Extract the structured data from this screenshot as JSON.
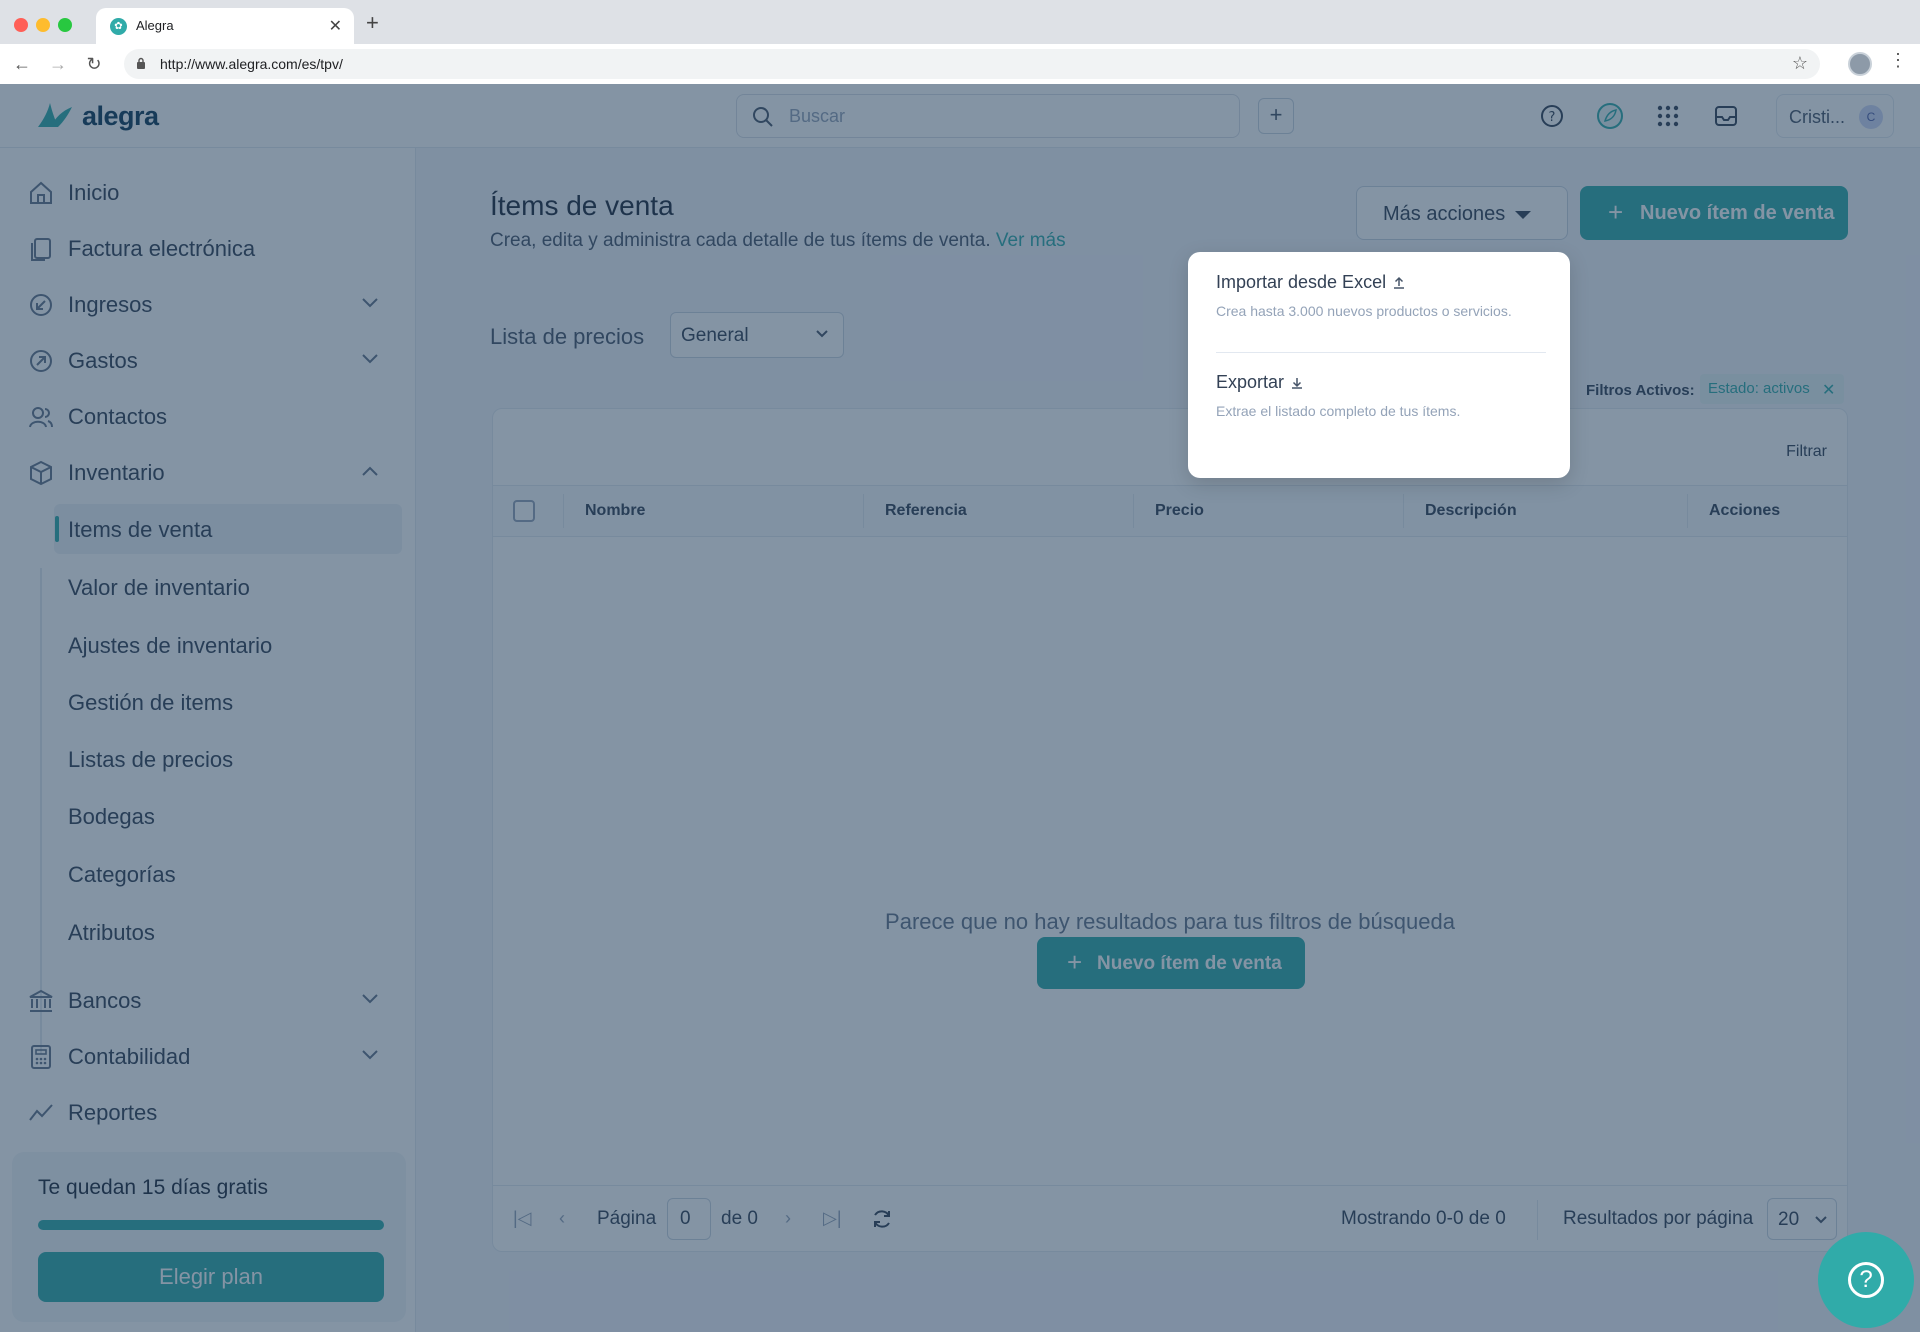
{
  "browser": {
    "tab_title": "Alegra",
    "url": "http://www.alegra.com/es/tpv/"
  },
  "topbar": {
    "logo_text": "alegra",
    "search_placeholder": "Buscar",
    "user_name": "Cristi...",
    "user_initial": "C"
  },
  "sidebar": {
    "items": [
      {
        "label": "Inicio",
        "icon": "home-icon"
      },
      {
        "label": "Factura electrónica",
        "icon": "invoice-icon"
      },
      {
        "label": "Ingresos",
        "icon": "income-icon",
        "expandable": true
      },
      {
        "label": "Gastos",
        "icon": "expense-icon",
        "expandable": true
      },
      {
        "label": "Contactos",
        "icon": "contacts-icon"
      },
      {
        "label": "Inventario",
        "icon": "box-icon",
        "expanded": true
      },
      {
        "label": "Bancos",
        "icon": "bank-icon",
        "expandable": true
      },
      {
        "label": "Contabilidad",
        "icon": "calculator-icon",
        "expandable": true
      },
      {
        "label": "Reportes",
        "icon": "chart-icon"
      }
    ],
    "inventory_sub": [
      {
        "label": "Items de venta",
        "active": true
      },
      {
        "label": "Valor de inventario"
      },
      {
        "label": "Ajustes de inventario"
      },
      {
        "label": "Gestión de items"
      },
      {
        "label": "Listas de precios"
      },
      {
        "label": "Bodegas"
      },
      {
        "label": "Categorías"
      },
      {
        "label": "Atributos"
      }
    ],
    "trial": {
      "text": "Te quedan 15 días gratis",
      "progress": 1.0,
      "button": "Elegir plan"
    }
  },
  "main": {
    "title": "Ítems de venta",
    "subtitle": "Crea, edita y administra cada detalle de tus ítems de venta.",
    "subtitle_link": "Ver más",
    "more_actions": "Más acciones",
    "new_item": "Nuevo ítem de venta",
    "pricelist_label": "Lista de precios",
    "pricelist_value": "General",
    "filters_label": "Filtros Activos:",
    "filter_chip": "Estado: activos",
    "filter_link": "Filtrar",
    "columns": [
      "Nombre",
      "Referencia",
      "Precio",
      "Descripción",
      "Acciones"
    ],
    "empty_text": "Parece que no hay resultados para tus filtros de búsqueda",
    "empty_button": "Nuevo ítem de venta",
    "pagination": {
      "page_label": "Página",
      "page_value": "0",
      "of_label": "de 0",
      "showing": "Mostrando 0-0 de 0",
      "per_page_label": "Resultados por página",
      "per_page_value": "20"
    }
  },
  "dropdown": {
    "items": [
      {
        "title": "Importar desde Excel",
        "desc": "Crea hasta 3.000 nuevos productos o servicios."
      },
      {
        "title": "Exportar",
        "desc": "Extrae el listado completo de tus ítems."
      }
    ]
  },
  "colors": {
    "brand": "#30aba9",
    "overlay": "#1f3c5a"
  }
}
